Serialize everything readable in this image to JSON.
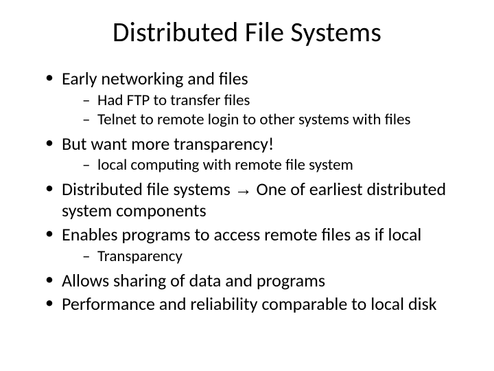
{
  "title": "Distributed File Systems",
  "bullets": {
    "b1": "Early networking and files",
    "b1a": "Had FTP to transfer files",
    "b1b": "Telnet to remote login to other systems with files",
    "b2": "But want more transparency!",
    "b2a": "local computing with remote file system",
    "b3_pre": "Distributed file systems ",
    "b3_arrow": "→",
    "b3_post": " One of earliest distributed system components",
    "b4": "Enables programs to access remote files as if local",
    "b4a": "Transparency",
    "b5": "Allows sharing of data and programs",
    "b6": "Performance and reliability comparable to local disk"
  }
}
